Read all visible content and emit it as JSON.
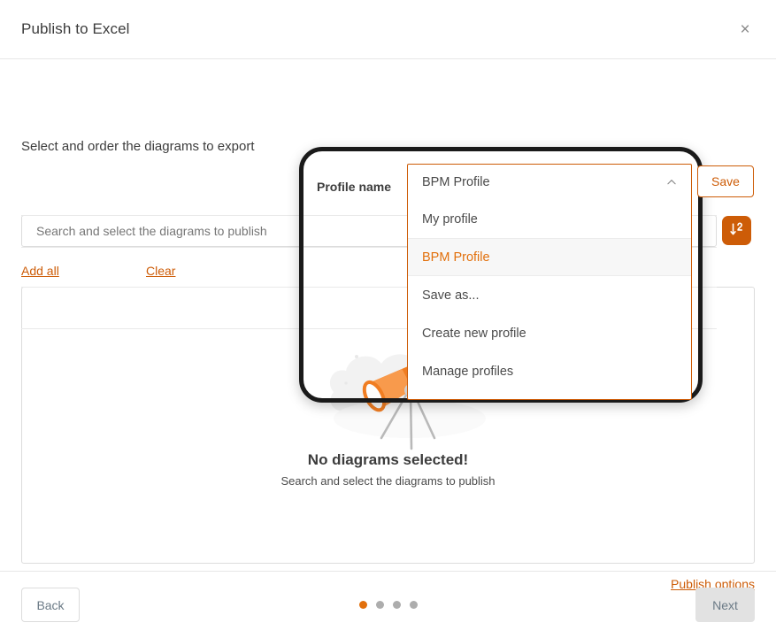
{
  "dialog": {
    "title": "Publish to Excel",
    "close_label": "×",
    "section_title": "Select and order the diagrams to export"
  },
  "profile": {
    "label": "Profile name",
    "selected_value": "BPM Profile",
    "save_label": "Save",
    "chevron_icon": "chevron-up-icon",
    "options": [
      {
        "label": "My profile",
        "selected": false
      },
      {
        "label": "BPM Profile",
        "selected": true
      },
      {
        "label": "Save as...",
        "selected": false
      },
      {
        "label": "Create new profile",
        "selected": false
      },
      {
        "label": "Manage profiles",
        "selected": false
      }
    ]
  },
  "search": {
    "value": "",
    "placeholder": "Search and select the diagrams to publish"
  },
  "sort": {
    "icon": "sort-descending-icon"
  },
  "links": {
    "add_all": "Add all",
    "clear": "Clear",
    "publish_options": "Publish options"
  },
  "empty_state": {
    "title": "No diagrams selected!",
    "subtitle": "Search and select the diagrams to publish",
    "illustration": "telescope-illustration"
  },
  "footer": {
    "back_label": "Back",
    "next_label": "Next",
    "steps": [
      {
        "active": true
      },
      {
        "active": false
      },
      {
        "active": false
      },
      {
        "active": false
      }
    ]
  },
  "colors": {
    "accent": "#cd5c07",
    "accent_light": "#e2700c",
    "text": "#3c3c3c",
    "border": "#dcdcdc",
    "disabled_bg": "#e2e2e2"
  }
}
